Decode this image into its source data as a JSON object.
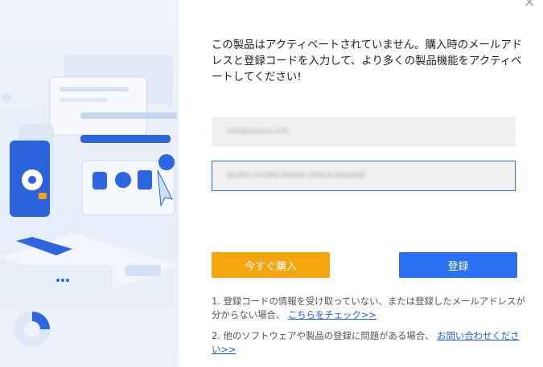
{
  "dialog": {
    "close_glyph": "×",
    "message": "この製品はアクティベートされていません。購入時のメールアドレスと登録コードを入力して、より多くの製品機能をアクティベートしてください!",
    "email_value": "info@easeus.info",
    "code_value": "9S2DC-6YQRG-N4FA8-1EWLR-FAVQWE",
    "buy_label": "今すぐ購入",
    "register_label": "登録",
    "note1_text": "1. 登録コードの情報を受け取っていない、または登録したメールアドレスが分からない場合、",
    "note1_link": "こちらをチェック>>",
    "note2_text": "2. 他のソフトウェアや製品の登録に問題がある場合、",
    "note2_link": "お問い合わせください>>"
  },
  "colors": {
    "buy": "#f5a60f",
    "register": "#2970f2",
    "link": "#1f5fd6",
    "focus_border": "#2f6fe4"
  },
  "icons": [
    "close-icon",
    "disk-icon",
    "lock-icon",
    "shield-icon",
    "bag-icon",
    "cursor-icon"
  ]
}
